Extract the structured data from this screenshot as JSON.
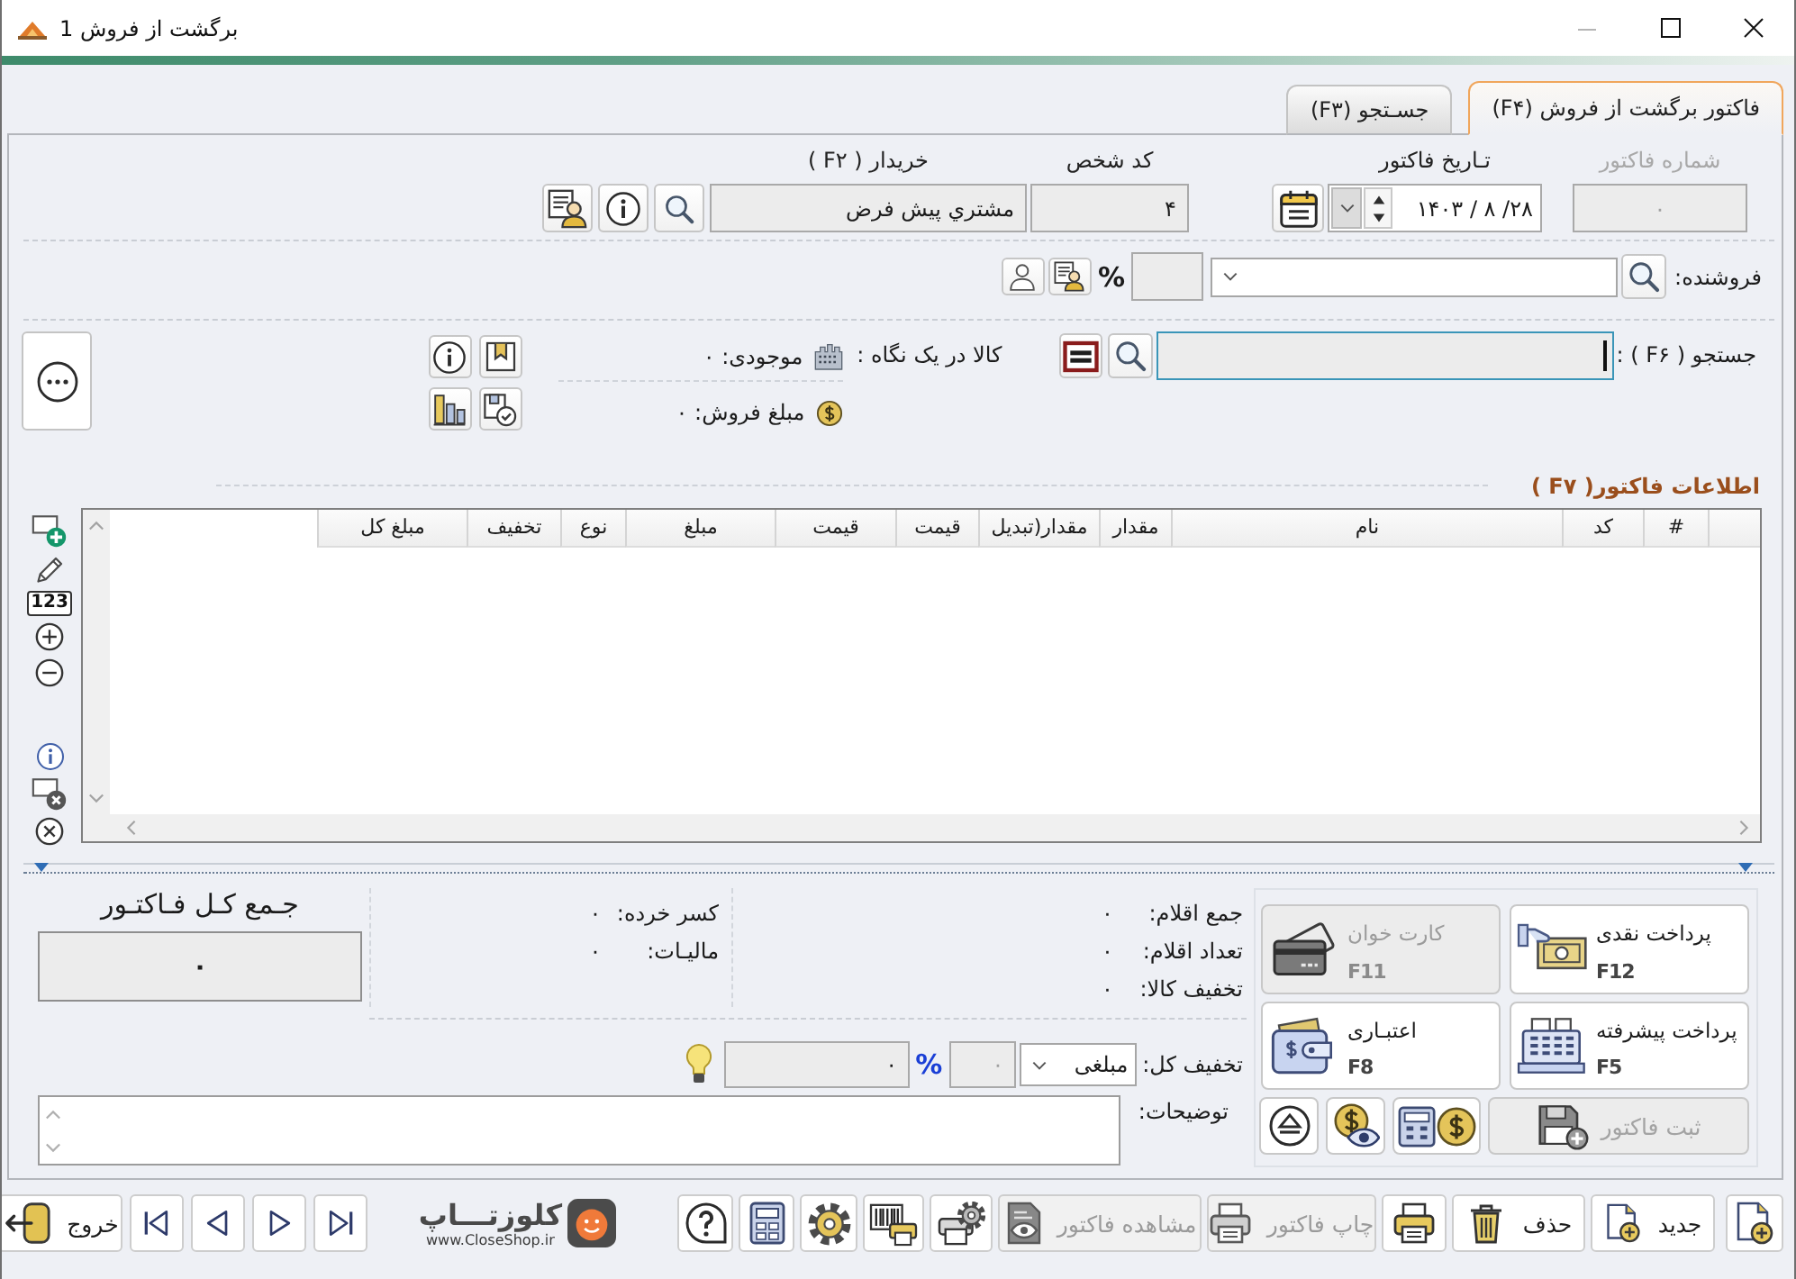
{
  "window": {
    "title": "برگشت از فروش 1"
  },
  "tabs": [
    {
      "label": "فاکتور برگشت از فروش (F۴)",
      "selected": true
    },
    {
      "label": "جسـتجو (F۳)",
      "selected": false
    }
  ],
  "header": {
    "invoice_number": {
      "label": "شماره فاکتور",
      "value": "۰",
      "disabled": true
    },
    "invoice_date": {
      "label": "تـاریخ فاکتور",
      "value": "۱۴۰۳ / ۸ /۲۸"
    },
    "person_code": {
      "label": "کد شخص",
      "value": "۴"
    },
    "buyer": {
      "label": "خریدار ( F۲ )",
      "value": "مشتري پيش فرض"
    }
  },
  "seller": {
    "label": "فروشنده:",
    "percent_sign": "%"
  },
  "product_search": {
    "label": "جستجو ( F۶ ) :",
    "focused": true,
    "glance_label": "کالا در یک نگاه :",
    "stock": "موجودی: ۰",
    "sales_amount": "مبلغ فروش: ۰"
  },
  "invoice_items": {
    "title": "اطلاعات فاکتور( F۷ )",
    "numbering_tool": "123",
    "columns": [
      "#",
      "کد",
      "نام",
      "مقدار",
      "مقدار(تبدیل",
      "قیمت",
      "قیمت",
      "مبلغ",
      "نوع",
      "تخفیف",
      "مبلغ کل"
    ]
  },
  "summary": {
    "items": [
      {
        "label": "جمع اقلام:",
        "value": "۰"
      },
      {
        "label": "تعداد اقلام:",
        "value": "۰"
      },
      {
        "label": "تخفیف کالا:",
        "value": "۰"
      }
    ],
    "adjustments": [
      {
        "label": "کسر خرده:",
        "value": "۰"
      },
      {
        "label": "مالیـات:",
        "value": "۰"
      }
    ],
    "grand_total": {
      "title": "جـمع کـل فـاکتـور",
      "value": "۰"
    }
  },
  "discount": {
    "label": "تخفیف کل:",
    "mode": "مبلغی",
    "percent": {
      "value": "۰",
      "disabled": true
    },
    "percent_sign": "%",
    "amount": "۰"
  },
  "notes": {
    "label": "توضیحات:"
  },
  "payments": [
    {
      "label": "پرداخت نقدی",
      "key": "F12",
      "kind": "cash",
      "disabled": false
    },
    {
      "label": "کارت خوان",
      "key": "F11",
      "kind": "card",
      "disabled": true
    },
    {
      "label": "پرداخت پیشرفته",
      "key": "F5",
      "kind": "advanced",
      "disabled": false
    },
    {
      "label": "اعتبـاری",
      "key": "F8",
      "kind": "credit",
      "disabled": false
    }
  ],
  "save_button": {
    "label": "ثبت فاکتور",
    "disabled": true
  },
  "toolbar": [
    {
      "kind": "new_blank",
      "disabled": false
    },
    {
      "kind": "new",
      "label": "جدید",
      "disabled": false
    },
    {
      "kind": "delete",
      "label": "حذف",
      "disabled": false
    },
    {
      "kind": "print",
      "disabled": false
    },
    {
      "kind": "print_invoice",
      "label": "چاپ فاکتور",
      "disabled": true
    },
    {
      "kind": "view_invoice",
      "label": "مشاهده فاکتور",
      "disabled": true
    },
    {
      "kind": "print_settings",
      "disabled": false
    },
    {
      "kind": "barcode",
      "disabled": false
    },
    {
      "kind": "settings",
      "disabled": false
    },
    {
      "kind": "calculator",
      "disabled": false
    },
    {
      "kind": "help",
      "disabled": false
    }
  ],
  "logo": {
    "name": "کلوزتـــاپ",
    "url": "www.CloseShop.ir"
  },
  "exit": {
    "label": "خروج"
  }
}
